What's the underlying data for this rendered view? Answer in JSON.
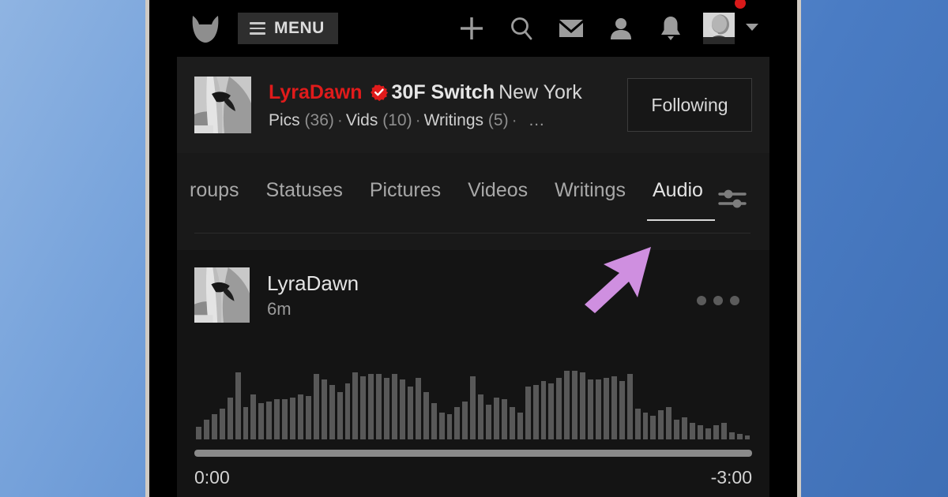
{
  "colors": {
    "accent_red": "#e01b1b",
    "page_bg_blue": "#4a7cc4",
    "frame_border": "#cfcac3",
    "cursor_purple": "#cf8fe0",
    "waveform_bar": "#585858",
    "progress_fill": "#8a8a8a",
    "notification_dot": "#d81919"
  },
  "topnav": {
    "logo_icon": "fox-head-logo-icon",
    "menu": {
      "label": "MENU",
      "icon": "hamburger-icon"
    },
    "actions": [
      {
        "name": "create-post",
        "icon": "plus-icon"
      },
      {
        "name": "search",
        "icon": "search-icon"
      },
      {
        "name": "messages",
        "icon": "envelope-icon"
      },
      {
        "name": "friends",
        "icon": "person-icon"
      },
      {
        "name": "notifications",
        "icon": "bell-icon"
      }
    ],
    "account": {
      "avatar_icon": "user-avatar-photo",
      "has_notification_dot": true,
      "chevron_icon": "chevron-down-icon"
    }
  },
  "profile": {
    "avatar_icon": "profile-avatar-photo",
    "handle": "LyraDawn",
    "verified_icon": "verified-badge-icon",
    "age_gender_role": "30F Switch",
    "location": "New York",
    "stats": [
      {
        "label": "Pics",
        "count": "(36)"
      },
      {
        "label": "Vids",
        "count": "(10)"
      },
      {
        "label": "Writings",
        "count": "(5)"
      }
    ],
    "stat_separator": "·",
    "stats_overflow": "…",
    "follow_button": "Following"
  },
  "tabs": {
    "items": [
      {
        "label": "roups",
        "active": false
      },
      {
        "label": "Statuses",
        "active": false
      },
      {
        "label": "Pictures",
        "active": false
      },
      {
        "label": "Videos",
        "active": false
      },
      {
        "label": "Writings",
        "active": false
      },
      {
        "label": "Audio",
        "active": true
      }
    ],
    "filter_icon": "sliders-filter-icon"
  },
  "post": {
    "avatar_icon": "post-author-avatar-photo",
    "author": "LyraDawn",
    "timestamp": "6m",
    "more_icon": "more-options-icon",
    "audio": {
      "waveform_icon": "audio-waveform",
      "bars": [
        14,
        22,
        28,
        34,
        46,
        74,
        36,
        50,
        40,
        42,
        44,
        44,
        46,
        50,
        48,
        72,
        66,
        60,
        52,
        62,
        74,
        70,
        72,
        72,
        68,
        72,
        66,
        58,
        68,
        52,
        40,
        30,
        28,
        36,
        42,
        70,
        50,
        38,
        46,
        44,
        36,
        30,
        58,
        60,
        64,
        62,
        68,
        76,
        76,
        74,
        66,
        66,
        68,
        70,
        64,
        72,
        34,
        30,
        26,
        32,
        36,
        22,
        24,
        18,
        16,
        12,
        16,
        18,
        8,
        6,
        4
      ],
      "progress_percent": 100,
      "time_elapsed": "0:00",
      "time_remaining": "-3:00"
    }
  },
  "cursor": {
    "icon": "mouse-pointer-arrow",
    "direction": "up-right"
  }
}
